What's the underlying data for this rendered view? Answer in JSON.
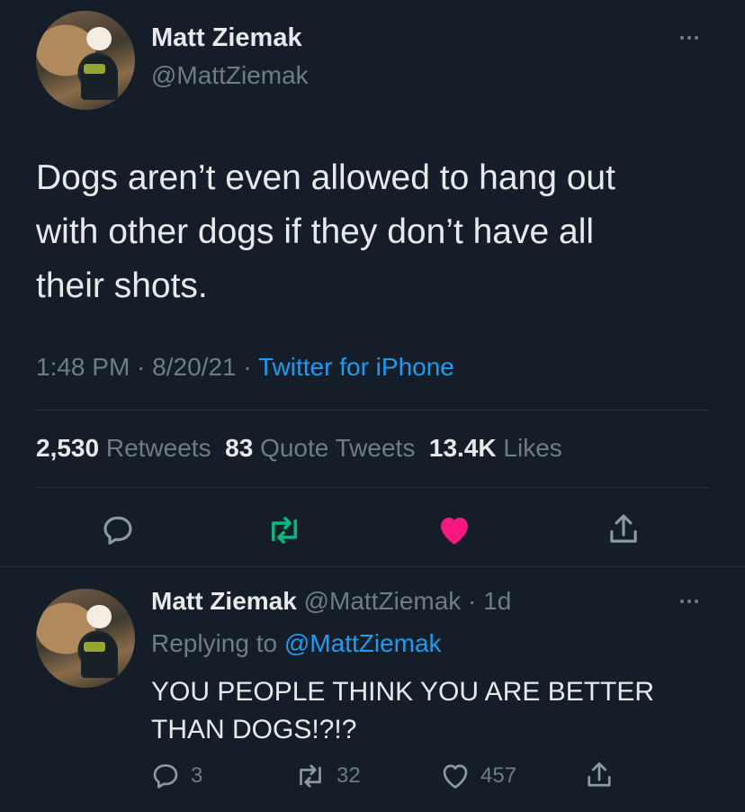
{
  "main_tweet": {
    "author_name": "Matt Ziemak",
    "author_handle": "@MattZiemak",
    "text_line1": "Dogs aren’t even allowed to hang out",
    "text_line2": "with other dogs if they don’t have all",
    "text_line3": "their shots.",
    "time": "1:48 PM",
    "sep1": " · ",
    "date": "8/20/21",
    "sep2": " · ",
    "source": "Twitter for iPhone",
    "stats": {
      "retweets_count": "2,530",
      "retweets_label": "Retweets",
      "quotes_count": "83",
      "quotes_label": "Quote Tweets",
      "likes_count": "13.4K",
      "likes_label": "Likes"
    }
  },
  "reply": {
    "author_name": "Matt Ziemak",
    "author_handle": "@MattZiemak",
    "sep": " · ",
    "age": "1d",
    "replying_prefix": "Replying to ",
    "replying_handle": "@MattZiemak",
    "text_line1": "YOU PEOPLE THINK YOU ARE BETTER",
    "text_line2": "THAN DOGS!?!?",
    "reply_count": "3",
    "retweet_count": "32",
    "like_count": "457"
  },
  "icons": {
    "main_more": "more-horizontal-icon",
    "reply": "comment-icon",
    "retweet": "retweet-icon",
    "like": "heart-icon",
    "share": "share-icon"
  },
  "colors": {
    "background": "#151e28",
    "text": "#e7e9ea",
    "muted": "#6e7c87",
    "link": "#1d9bf0",
    "retweet_active": "#00ba7c",
    "like_active": "#f91880",
    "divider": "#2c3640"
  }
}
